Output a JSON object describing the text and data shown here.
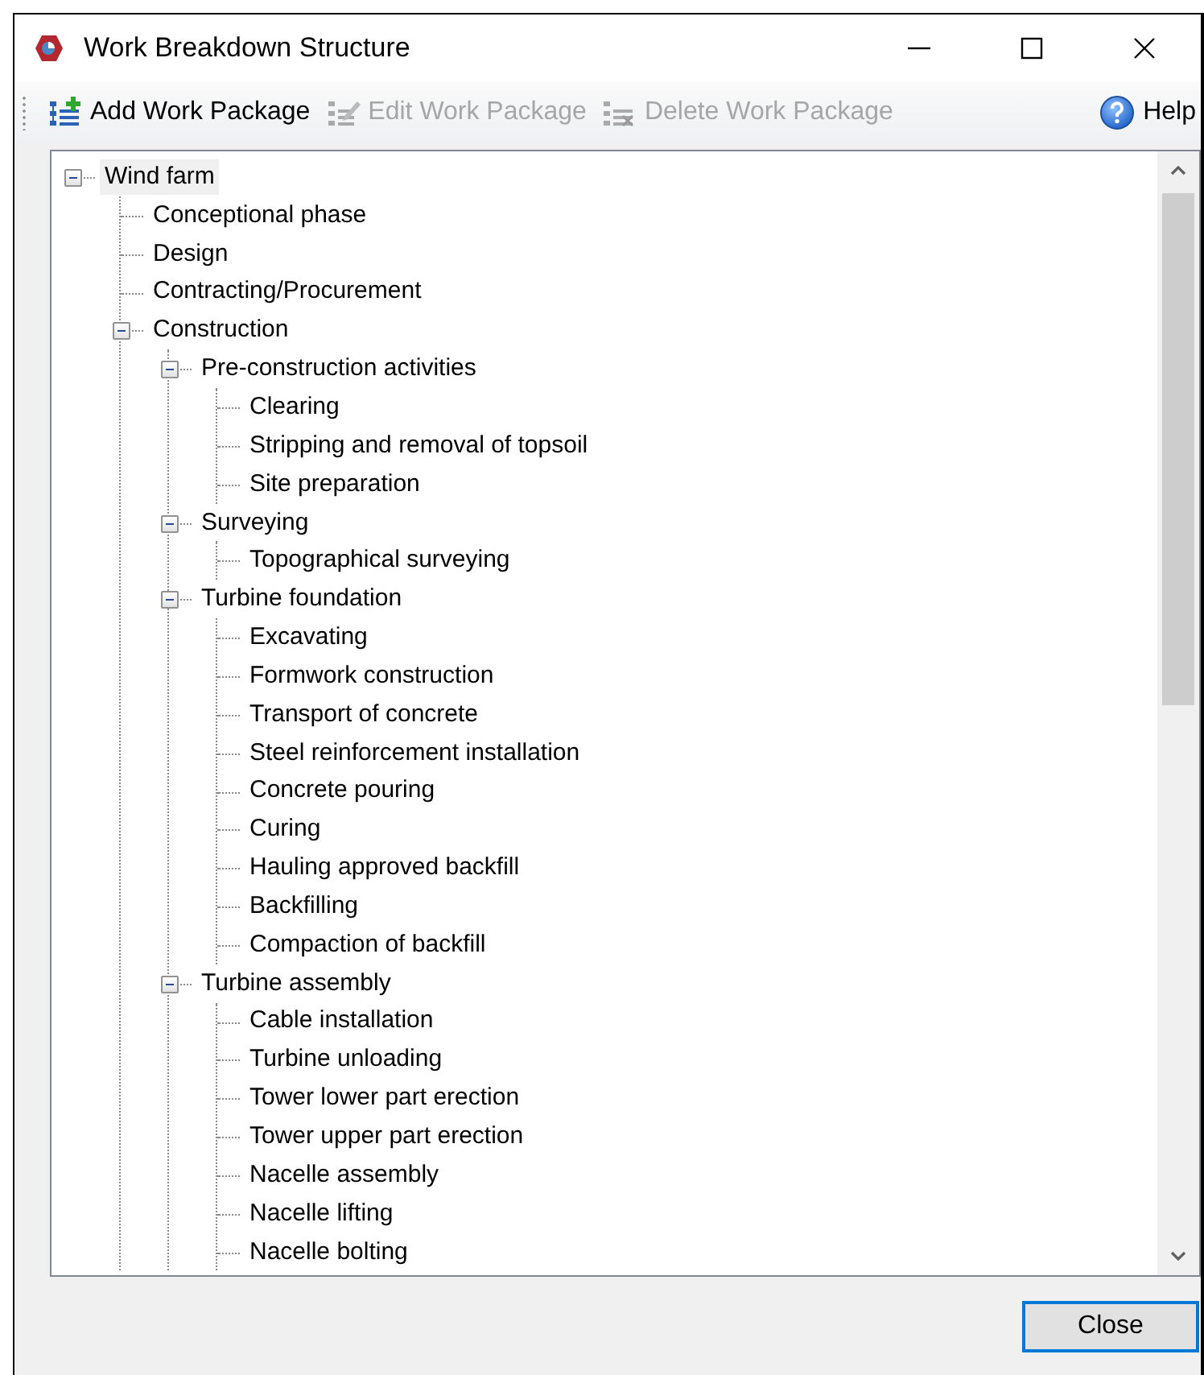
{
  "window": {
    "title": "Work Breakdown Structure"
  },
  "toolbar": {
    "buttons": [
      {
        "kind": "add",
        "label": "Add Work Package",
        "disabled": false
      },
      {
        "kind": "edit",
        "label": "Edit Work Package",
        "disabled": true
      },
      {
        "kind": "delete",
        "label": "Delete Work Package",
        "disabled": true
      }
    ],
    "help": {
      "label": "Help"
    }
  },
  "tree": {
    "nodes": [
      {
        "label": "Wind farm",
        "selected": true,
        "expanded": true,
        "children": [
          {
            "label": "Conceptional phase",
            "selected": false
          },
          {
            "label": "Design",
            "selected": false
          },
          {
            "label": "Contracting/Procurement",
            "selected": false
          },
          {
            "label": "Construction",
            "selected": false,
            "expanded": true,
            "children": [
              {
                "label": "Pre-construction activities",
                "selected": false,
                "expanded": true,
                "children": [
                  {
                    "label": "Clearing",
                    "selected": false
                  },
                  {
                    "label": "Stripping and removal of topsoil",
                    "selected": false
                  },
                  {
                    "label": "Site preparation",
                    "selected": false
                  }
                ]
              },
              {
                "label": "Surveying",
                "selected": false,
                "expanded": true,
                "children": [
                  {
                    "label": "Topographical surveying",
                    "selected": false
                  }
                ]
              },
              {
                "label": "Turbine foundation",
                "selected": false,
                "expanded": true,
                "children": [
                  {
                    "label": "Excavating",
                    "selected": false
                  },
                  {
                    "label": "Formwork construction",
                    "selected": false
                  },
                  {
                    "label": "Transport of concrete",
                    "selected": false
                  },
                  {
                    "label": "Steel reinforcement installation",
                    "selected": false
                  },
                  {
                    "label": "Concrete pouring",
                    "selected": false
                  },
                  {
                    "label": "Curing",
                    "selected": false
                  },
                  {
                    "label": "Hauling approved backfill",
                    "selected": false
                  },
                  {
                    "label": "Backfilling",
                    "selected": false
                  },
                  {
                    "label": "Compaction of backfill",
                    "selected": false
                  }
                ]
              },
              {
                "label": "Turbine assembly",
                "selected": false,
                "expanded": true,
                "children": [
                  {
                    "label": "Cable installation",
                    "selected": false
                  },
                  {
                    "label": "Turbine unloading",
                    "selected": false
                  },
                  {
                    "label": "Tower lower part erection",
                    "selected": false
                  },
                  {
                    "label": "Tower upper part erection",
                    "selected": false
                  },
                  {
                    "label": "Nacelle assembly",
                    "selected": false
                  },
                  {
                    "label": "Nacelle lifting",
                    "selected": false
                  },
                  {
                    "label": "Nacelle bolting",
                    "selected": false
                  }
                ]
              }
            ]
          }
        ]
      }
    ]
  },
  "buttons": [
    {
      "label": "Close",
      "focused": true
    }
  ]
}
